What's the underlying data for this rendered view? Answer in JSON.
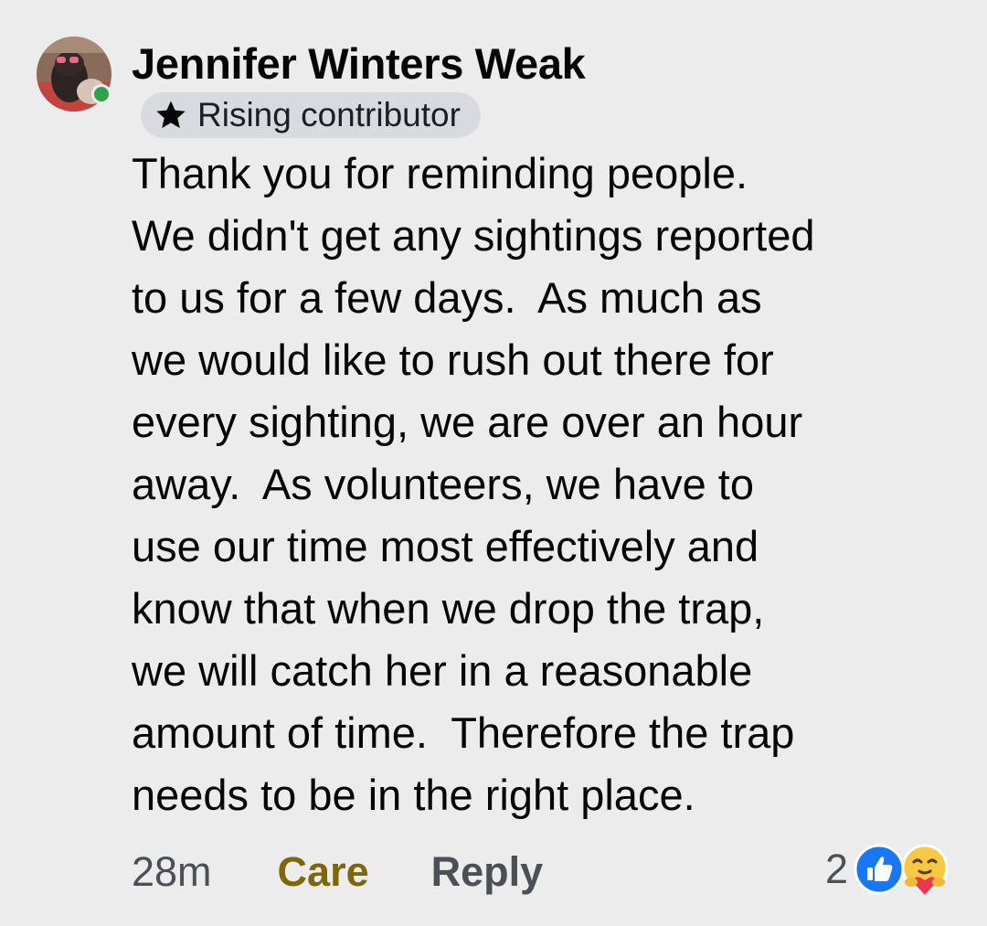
{
  "author": {
    "name": "Jennifer Winters Weak",
    "badge_label": "Rising contributor",
    "badge_icon": "star-icon",
    "online": true,
    "online_color": "#31a24c"
  },
  "comment": {
    "lines": [
      "Thank you for reminding people.",
      "We didn't get any sightings reported",
      "to us for a few days.  As much as",
      "we would like to rush out there for",
      "every sighting, we are over an hour",
      "away.  As volunteers, we have to",
      "use our time most effectively and",
      "know that when we drop the trap,",
      "we will catch her in a reasonable",
      "amount of time.  Therefore the trap",
      "needs to be in the right place."
    ]
  },
  "actions": {
    "timestamp": "28m",
    "care_label": "Care",
    "care_color": "#7d6708",
    "reply_label": "Reply"
  },
  "reactions": {
    "count": "2",
    "icons": [
      "like-icon",
      "care-icon"
    ],
    "like_color": "#1877f2"
  }
}
